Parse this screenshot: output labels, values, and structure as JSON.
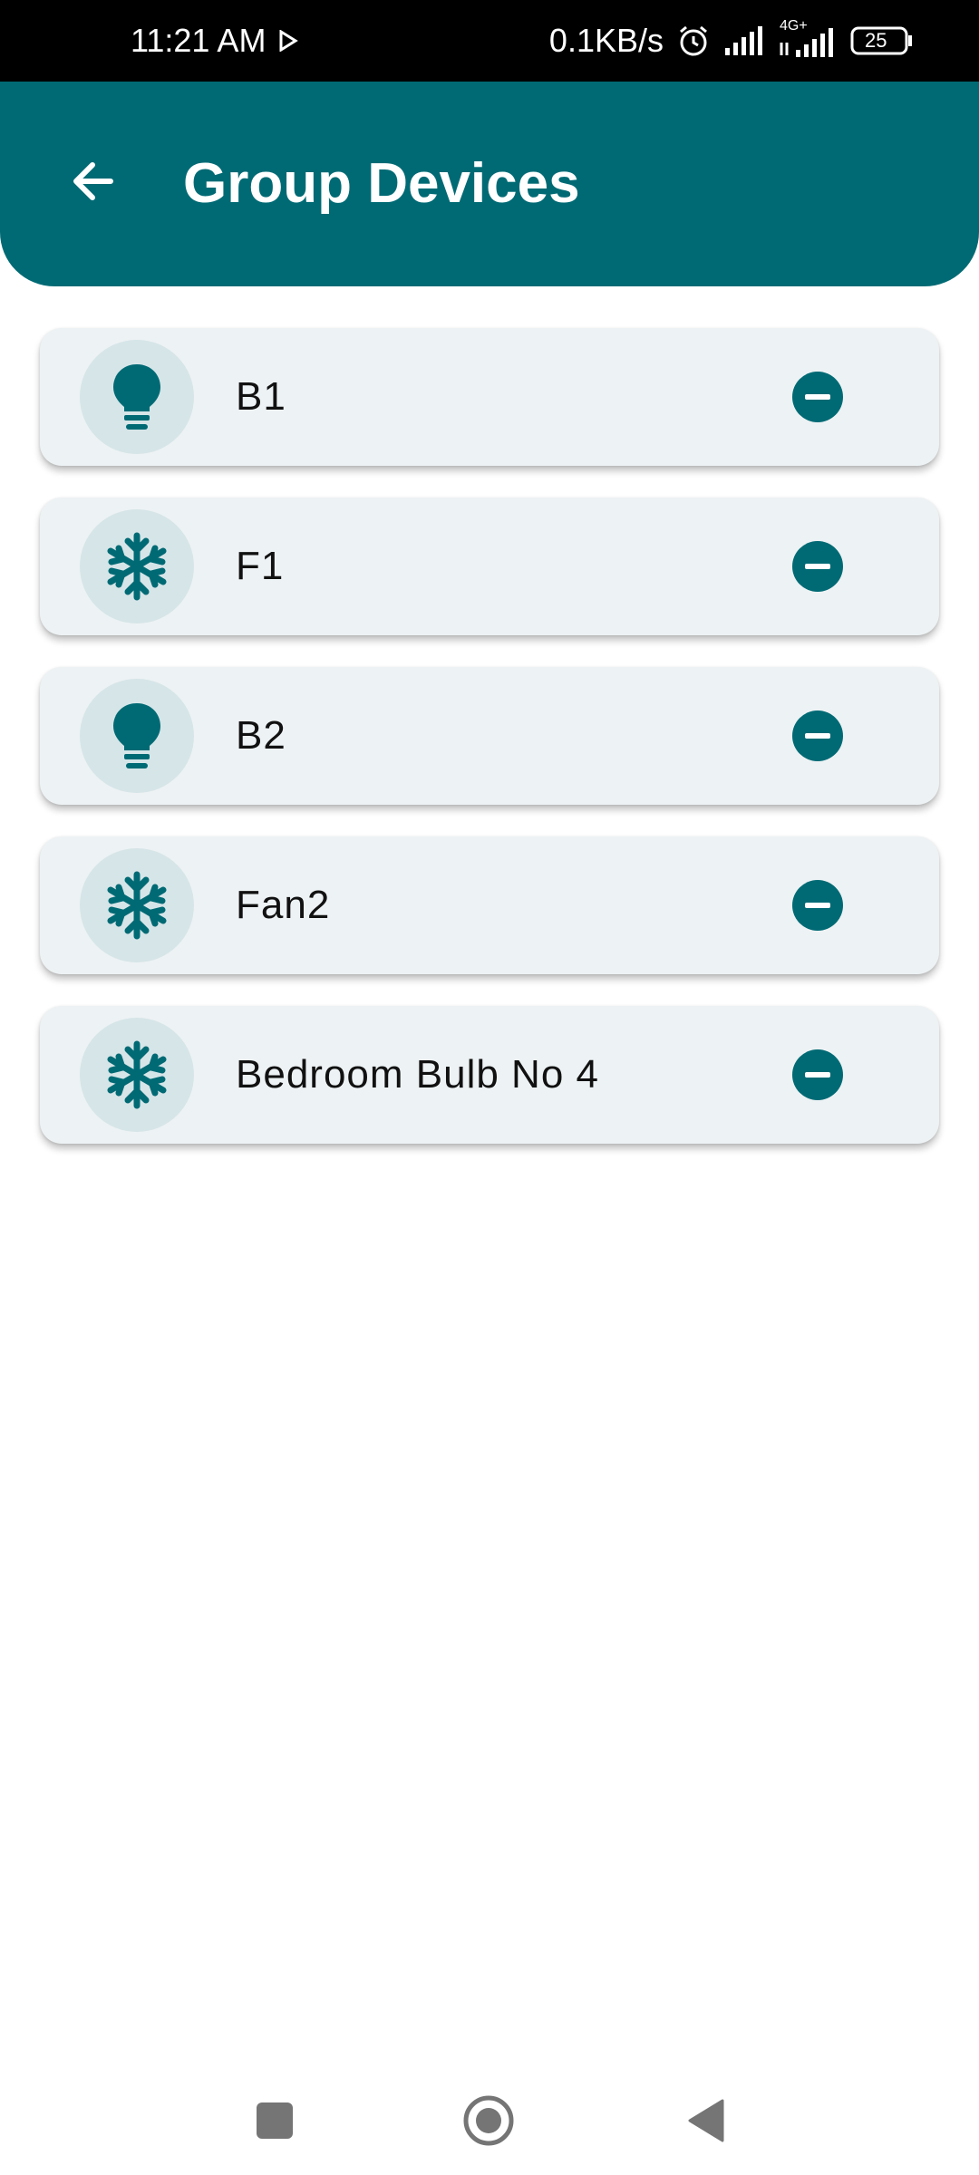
{
  "status_bar": {
    "time": "11:21 AM",
    "net_speed": "0.1KB/s",
    "network_type": "4G+",
    "battery": "25"
  },
  "header": {
    "title": "Group Devices",
    "back_icon": "arrow-back-icon",
    "color": "#006a74"
  },
  "devices": [
    {
      "name": "B1",
      "icon": "lightbulb-icon"
    },
    {
      "name": "F1",
      "icon": "snowflake-icon"
    },
    {
      "name": "B2",
      "icon": "lightbulb-icon"
    },
    {
      "name": "Fan2",
      "icon": "snowflake-icon"
    },
    {
      "name": "Bedroom Bulb No 4",
      "icon": "snowflake-icon"
    }
  ],
  "colors": {
    "accent": "#006a74",
    "card_bg": "#edf2f4",
    "avatar_bg": "#d6e5e8"
  }
}
